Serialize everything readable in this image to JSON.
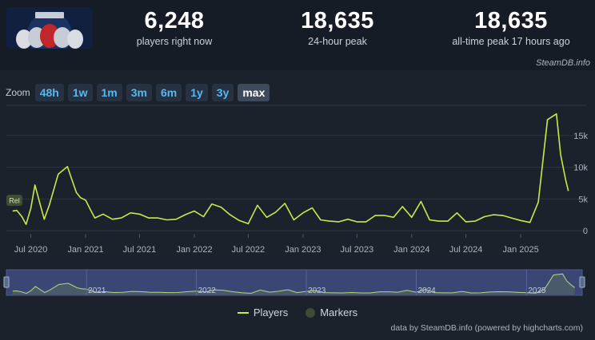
{
  "stats": [
    {
      "value": "6,248",
      "label": "players right now"
    },
    {
      "value": "18,635",
      "label": "24-hour peak"
    },
    {
      "value": "18,635",
      "label": "all-time peak 17 hours ago"
    }
  ],
  "credit_top": "SteamDB.info",
  "zoom": {
    "label": "Zoom",
    "buttons": [
      "48h",
      "1w",
      "1m",
      "3m",
      "6m",
      "1y",
      "3y",
      "max"
    ],
    "active": "max"
  },
  "legend": {
    "players": "Players",
    "markers": "Markers"
  },
  "credit_bottom": "data by SteamDB.info (powered by highcharts.com)",
  "colors": {
    "line": "#cbe847",
    "navigator_bg": "#3a4775",
    "background": "#1b222c"
  },
  "chart_data": {
    "type": "line",
    "series": [
      {
        "name": "Players",
        "x": [
          "2020-05-01",
          "2020-05-15",
          "2020-06-01",
          "2020-06-15",
          "2020-07-01",
          "2020-07-15",
          "2020-08-01",
          "2020-08-15",
          "2020-09-01",
          "2020-10-01",
          "2020-11-01",
          "2020-12-01",
          "2020-12-15",
          "2021-01-01",
          "2021-01-15",
          "2021-02-01",
          "2021-03-01",
          "2021-04-01",
          "2021-05-01",
          "2021-06-01",
          "2021-07-01",
          "2021-08-01",
          "2021-09-01",
          "2021-10-01",
          "2021-11-01",
          "2021-12-01",
          "2022-01-01",
          "2022-02-01",
          "2022-03-01",
          "2022-04-01",
          "2022-05-01",
          "2022-06-01",
          "2022-07-01",
          "2022-08-01",
          "2022-09-01",
          "2022-10-01",
          "2022-11-01",
          "2022-12-01",
          "2023-01-01",
          "2023-02-01",
          "2023-03-01",
          "2023-04-01",
          "2023-05-01",
          "2023-06-01",
          "2023-07-01",
          "2023-08-01",
          "2023-09-01",
          "2023-10-01",
          "2023-11-01",
          "2023-12-01",
          "2024-01-01",
          "2024-02-01",
          "2024-03-01",
          "2024-04-01",
          "2024-05-01",
          "2024-06-01",
          "2024-07-01",
          "2024-08-01",
          "2024-09-01",
          "2024-10-01",
          "2024-11-01",
          "2024-12-01",
          "2025-01-01",
          "2025-02-01",
          "2025-03-01",
          "2025-04-01",
          "2025-05-01",
          "2025-05-15",
          "2025-06-01",
          "2025-06-10"
        ],
        "values": [
          3100,
          3200,
          2200,
          1000,
          3500,
          7200,
          4200,
          1800,
          4000,
          8900,
          10100,
          6000,
          5200,
          4800,
          3500,
          2000,
          2600,
          1800,
          2000,
          2800,
          2600,
          2000,
          2000,
          1700,
          1800,
          2500,
          3100,
          2200,
          4200,
          3700,
          2500,
          1600,
          1100,
          4000,
          2100,
          2900,
          4300,
          1700,
          2800,
          3600,
          1700,
          1500,
          1400,
          1800,
          1400,
          1400,
          2400,
          2400,
          2100,
          3800,
          2100,
          4600,
          1700,
          1500,
          1500,
          2800,
          1400,
          1500,
          2200,
          2500,
          2400,
          2000,
          1600,
          1300,
          4500,
          17500,
          18400,
          12000,
          8000,
          6248
        ]
      }
    ],
    "x_ticks": [
      "Jul 2020",
      "Jan 2021",
      "Jul 2021",
      "Jan 2022",
      "Jul 2022",
      "Jan 2023",
      "Jul 2023",
      "Jan 2024",
      "Jul 2024",
      "Jan 2025"
    ],
    "y_ticks": [
      "0",
      "5k",
      "10k",
      "15k"
    ],
    "ylim": [
      0,
      20000
    ],
    "marker_label": "Rel",
    "navigator": {
      "labels": [
        "2021",
        "2022",
        "2023",
        "2024",
        "2025"
      ]
    }
  }
}
